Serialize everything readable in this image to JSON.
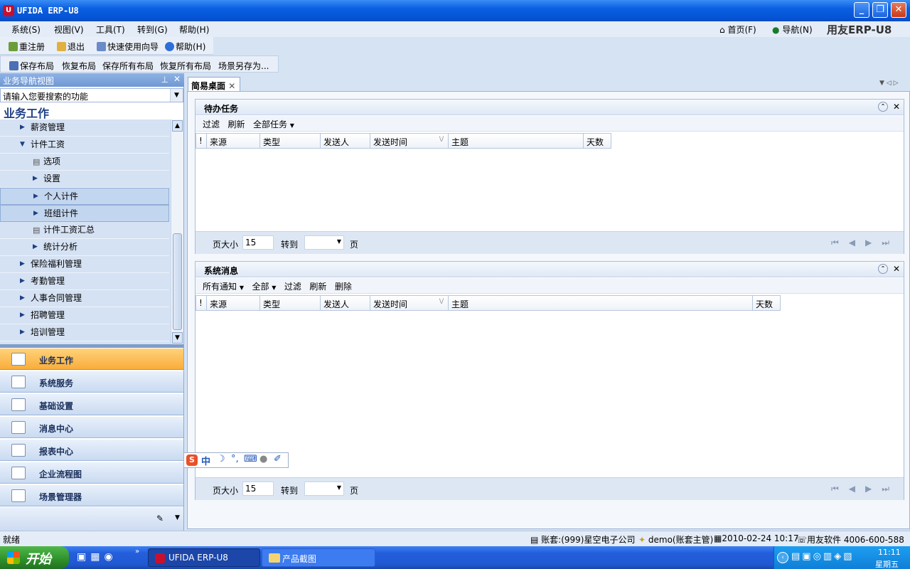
{
  "window": {
    "title": "UFIDA ERP-U8",
    "logo": "U"
  },
  "menu": [
    {
      "label": "系统(S)"
    },
    {
      "label": "视图(V)"
    },
    {
      "label": "工具(T)"
    },
    {
      "label": "转到(G)"
    },
    {
      "label": "帮助(H)"
    }
  ],
  "topright": {
    "home": "首页(F)",
    "nav": "导航(N)",
    "brand": "用友ERP-U8"
  },
  "toolbar1": [
    "重注册",
    "退出",
    "快速使用向导",
    "帮助(H)"
  ],
  "toolbar2": [
    "保存布局",
    "恢复布局",
    "保存所有布局",
    "恢复所有布局",
    "场景另存为..."
  ],
  "leftpanel": {
    "header": "业务导航视图",
    "search_placeholder": "请输入您要搜索的功能",
    "title": "业务工作",
    "tree": [
      {
        "label": "薪资管理",
        "level": 1,
        "type": "arrow"
      },
      {
        "label": "计件工资",
        "level": 1,
        "type": "open"
      },
      {
        "label": "选项",
        "level": 2,
        "type": "doc"
      },
      {
        "label": "设置",
        "level": 2,
        "type": "arrow"
      },
      {
        "label": "个人计件",
        "level": 2,
        "type": "arrow",
        "selected": true
      },
      {
        "label": "班组计件",
        "level": 2,
        "type": "arrow",
        "selected": true
      },
      {
        "label": "计件工资汇总",
        "level": 2,
        "type": "doc"
      },
      {
        "label": "统计分析",
        "level": 2,
        "type": "arrow"
      },
      {
        "label": "保险福利管理",
        "level": 1,
        "type": "arrow"
      },
      {
        "label": "考勤管理",
        "level": 1,
        "type": "arrow"
      },
      {
        "label": "人事合同管理",
        "level": 1,
        "type": "arrow"
      },
      {
        "label": "招聘管理",
        "level": 1,
        "type": "arrow"
      },
      {
        "label": "培训管理",
        "level": 1,
        "type": "arrow"
      }
    ],
    "nav": [
      {
        "label": "业务工作",
        "active": true
      },
      {
        "label": "系统服务"
      },
      {
        "label": "基础设置"
      },
      {
        "label": "消息中心"
      },
      {
        "label": "报表中心"
      },
      {
        "label": "企业流程图"
      },
      {
        "label": "场景管理器"
      }
    ]
  },
  "tab": {
    "label": "简易桌面"
  },
  "todo": {
    "title": "待办任务",
    "tools": [
      "过滤",
      "刷新",
      "全部任务"
    ],
    "columns": [
      "!",
      "来源",
      "类型",
      "发送人",
      "发送时间",
      "主题",
      "天数"
    ],
    "sort_mark": "\\/",
    "page_size_label": "页大小",
    "page_size": "15",
    "goto_label": "转到",
    "page_label": "页"
  },
  "messages": {
    "title": "系统消息",
    "tools": [
      "所有通知",
      "全部",
      "过滤",
      "刷新",
      "删除"
    ],
    "columns": [
      "!",
      "来源",
      "类型",
      "发送人",
      "发送时间",
      "主题",
      "天数"
    ],
    "sort_mark": "\\/",
    "page_size_label": "页大小",
    "page_size": "15",
    "goto_label": "转到",
    "page_label": "页"
  },
  "ime": {
    "mode": "中",
    "logo": "S"
  },
  "status": {
    "left": "就绪",
    "account": "账套:(999)星空电子公司",
    "user": "demo(账套主管)",
    "datetime": "2010-02-24  10:17",
    "company": "用友软件 4006-600-588"
  },
  "taskbar": {
    "start": "开始",
    "tasks": [
      "UFIDA ERP-U8",
      "产品截图"
    ],
    "time": "11:11",
    "weekday": "星期五"
  }
}
